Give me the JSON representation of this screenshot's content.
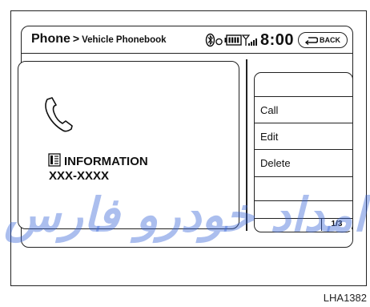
{
  "header": {
    "title": "Phone",
    "separator": ">",
    "subtitle": "Vehicle Phonebook",
    "clock": "8:00",
    "back_label": "BACK"
  },
  "icons": {
    "bluetooth": "bluetooth-icon",
    "battery": "battery-icon",
    "signal": "signal-strength-icon",
    "phone": "phone-handset-icon",
    "info": "info-card-icon",
    "back": "back-arrow-icon"
  },
  "contact": {
    "label": "INFORMATION",
    "number": "XXX-XXXX"
  },
  "menu": {
    "items": [
      {
        "label": ""
      },
      {
        "label": "Call"
      },
      {
        "label": "Edit"
      },
      {
        "label": "Delete"
      },
      {
        "label": ""
      },
      {
        "label": ""
      }
    ],
    "page_indicator": "1/3"
  },
  "watermark": "امداد خودرو فارس",
  "figure_id": "LHA1382"
}
